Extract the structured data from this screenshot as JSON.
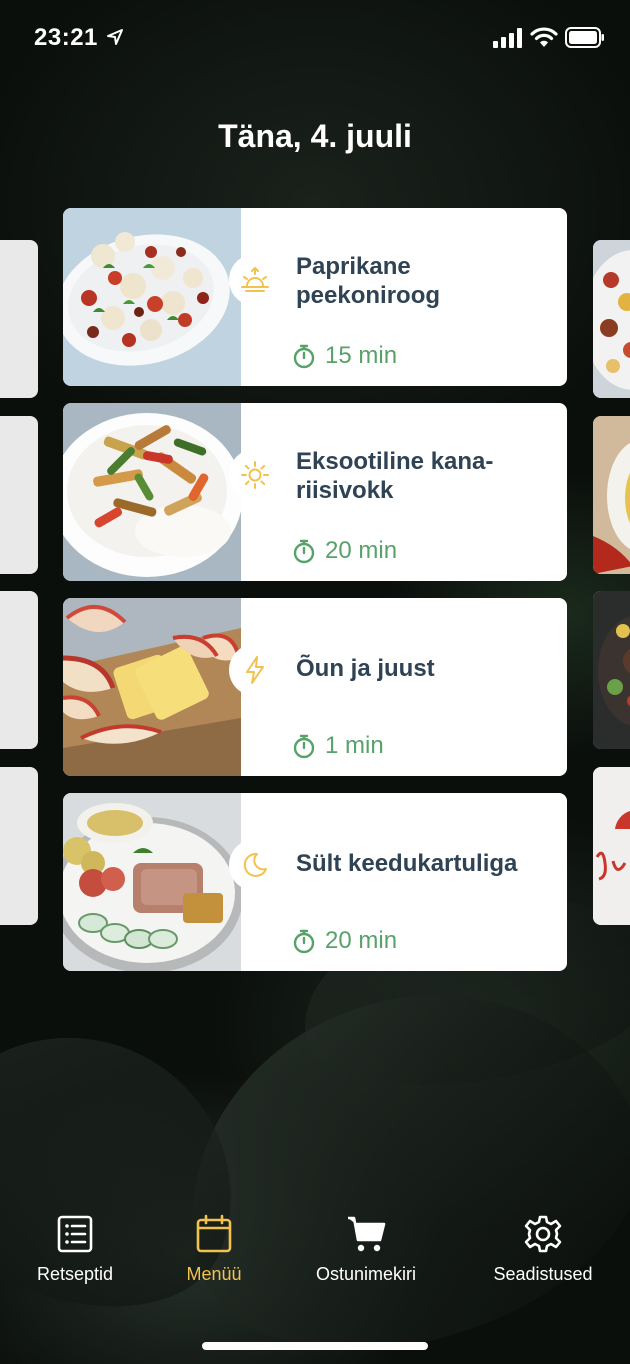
{
  "status_bar": {
    "time": "23:21"
  },
  "header": {
    "title": "Täna, 4. juuli"
  },
  "meals": [
    {
      "type_icon": "sunrise-icon",
      "name": "Paprikane peekoniroog",
      "duration": "15 min"
    },
    {
      "type_icon": "sun-icon",
      "name": "Eksootiline kana-riisivokk",
      "duration": "20 min"
    },
    {
      "type_icon": "lightning-icon",
      "name": "Õun ja juust",
      "duration": "1 min"
    },
    {
      "type_icon": "moon-icon",
      "name": "Sült keedukartuliga",
      "duration": "20 min"
    }
  ],
  "tabs": [
    {
      "label": "Retseptid",
      "icon": "list-icon",
      "active": false
    },
    {
      "label": "Menüü",
      "icon": "calendar-icon",
      "active": true
    },
    {
      "label": "Ostunimekiri",
      "icon": "cart-icon",
      "active": false
    },
    {
      "label": "Seadistused",
      "icon": "gear-icon",
      "active": false
    }
  ],
  "colors": {
    "accent": "#f2c24f",
    "time_green": "#58a26a",
    "title_navy": "#2f4354"
  }
}
